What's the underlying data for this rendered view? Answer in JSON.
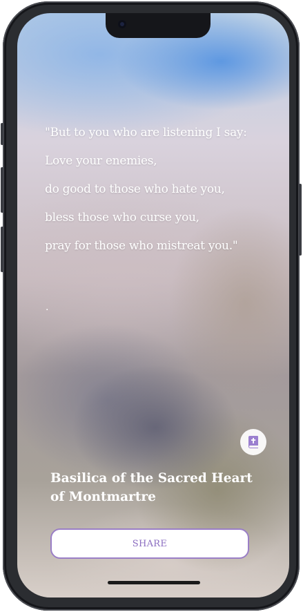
{
  "verse": {
    "lines": [
      "\"But to you who are listening I say:",
      "Love your enemies,",
      "do good to those who hate you,",
      "bless those who curse you,",
      "pray for those who mistreat you.\""
    ],
    "reference": "."
  },
  "place": {
    "title": "Basilica of the Sacred Heart of Montmartre"
  },
  "actions": {
    "share_label": "SHARE",
    "bible_icon": "bible-icon"
  },
  "colors": {
    "accent": "#8a6cc0",
    "accent_border": "#9a7ec6",
    "bible_icon": "#9b7fcf"
  }
}
